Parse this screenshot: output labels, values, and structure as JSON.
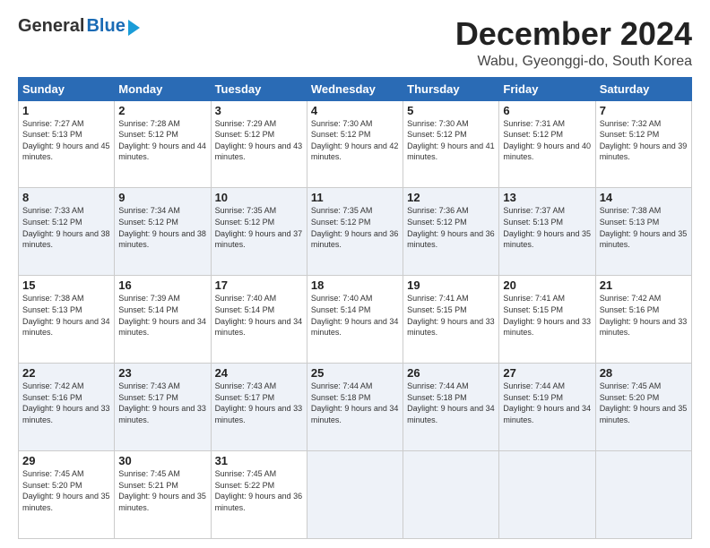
{
  "header": {
    "logo_general": "General",
    "logo_blue": "Blue",
    "month_title": "December 2024",
    "subtitle": "Wabu, Gyeonggi-do, South Korea"
  },
  "weekdays": [
    "Sunday",
    "Monday",
    "Tuesday",
    "Wednesday",
    "Thursday",
    "Friday",
    "Saturday"
  ],
  "weeks": [
    [
      {
        "day": "1",
        "sunrise": "7:27 AM",
        "sunset": "5:13 PM",
        "daylight": "9 hours and 45 minutes."
      },
      {
        "day": "2",
        "sunrise": "7:28 AM",
        "sunset": "5:12 PM",
        "daylight": "9 hours and 44 minutes."
      },
      {
        "day": "3",
        "sunrise": "7:29 AM",
        "sunset": "5:12 PM",
        "daylight": "9 hours and 43 minutes."
      },
      {
        "day": "4",
        "sunrise": "7:30 AM",
        "sunset": "5:12 PM",
        "daylight": "9 hours and 42 minutes."
      },
      {
        "day": "5",
        "sunrise": "7:30 AM",
        "sunset": "5:12 PM",
        "daylight": "9 hours and 41 minutes."
      },
      {
        "day": "6",
        "sunrise": "7:31 AM",
        "sunset": "5:12 PM",
        "daylight": "9 hours and 40 minutes."
      },
      {
        "day": "7",
        "sunrise": "7:32 AM",
        "sunset": "5:12 PM",
        "daylight": "9 hours and 39 minutes."
      }
    ],
    [
      {
        "day": "8",
        "sunrise": "7:33 AM",
        "sunset": "5:12 PM",
        "daylight": "9 hours and 38 minutes."
      },
      {
        "day": "9",
        "sunrise": "7:34 AM",
        "sunset": "5:12 PM",
        "daylight": "9 hours and 38 minutes."
      },
      {
        "day": "10",
        "sunrise": "7:35 AM",
        "sunset": "5:12 PM",
        "daylight": "9 hours and 37 minutes."
      },
      {
        "day": "11",
        "sunrise": "7:35 AM",
        "sunset": "5:12 PM",
        "daylight": "9 hours and 36 minutes."
      },
      {
        "day": "12",
        "sunrise": "7:36 AM",
        "sunset": "5:12 PM",
        "daylight": "9 hours and 36 minutes."
      },
      {
        "day": "13",
        "sunrise": "7:37 AM",
        "sunset": "5:13 PM",
        "daylight": "9 hours and 35 minutes."
      },
      {
        "day": "14",
        "sunrise": "7:38 AM",
        "sunset": "5:13 PM",
        "daylight": "9 hours and 35 minutes."
      }
    ],
    [
      {
        "day": "15",
        "sunrise": "7:38 AM",
        "sunset": "5:13 PM",
        "daylight": "9 hours and 34 minutes."
      },
      {
        "day": "16",
        "sunrise": "7:39 AM",
        "sunset": "5:14 PM",
        "daylight": "9 hours and 34 minutes."
      },
      {
        "day": "17",
        "sunrise": "7:40 AM",
        "sunset": "5:14 PM",
        "daylight": "9 hours and 34 minutes."
      },
      {
        "day": "18",
        "sunrise": "7:40 AM",
        "sunset": "5:14 PM",
        "daylight": "9 hours and 34 minutes."
      },
      {
        "day": "19",
        "sunrise": "7:41 AM",
        "sunset": "5:15 PM",
        "daylight": "9 hours and 33 minutes."
      },
      {
        "day": "20",
        "sunrise": "7:41 AM",
        "sunset": "5:15 PM",
        "daylight": "9 hours and 33 minutes."
      },
      {
        "day": "21",
        "sunrise": "7:42 AM",
        "sunset": "5:16 PM",
        "daylight": "9 hours and 33 minutes."
      }
    ],
    [
      {
        "day": "22",
        "sunrise": "7:42 AM",
        "sunset": "5:16 PM",
        "daylight": "9 hours and 33 minutes."
      },
      {
        "day": "23",
        "sunrise": "7:43 AM",
        "sunset": "5:17 PM",
        "daylight": "9 hours and 33 minutes."
      },
      {
        "day": "24",
        "sunrise": "7:43 AM",
        "sunset": "5:17 PM",
        "daylight": "9 hours and 33 minutes."
      },
      {
        "day": "25",
        "sunrise": "7:44 AM",
        "sunset": "5:18 PM",
        "daylight": "9 hours and 34 minutes."
      },
      {
        "day": "26",
        "sunrise": "7:44 AM",
        "sunset": "5:18 PM",
        "daylight": "9 hours and 34 minutes."
      },
      {
        "day": "27",
        "sunrise": "7:44 AM",
        "sunset": "5:19 PM",
        "daylight": "9 hours and 34 minutes."
      },
      {
        "day": "28",
        "sunrise": "7:45 AM",
        "sunset": "5:20 PM",
        "daylight": "9 hours and 35 minutes."
      }
    ],
    [
      {
        "day": "29",
        "sunrise": "7:45 AM",
        "sunset": "5:20 PM",
        "daylight": "9 hours and 35 minutes."
      },
      {
        "day": "30",
        "sunrise": "7:45 AM",
        "sunset": "5:21 PM",
        "daylight": "9 hours and 35 minutes."
      },
      {
        "day": "31",
        "sunrise": "7:45 AM",
        "sunset": "5:22 PM",
        "daylight": "9 hours and 36 minutes."
      },
      null,
      null,
      null,
      null
    ]
  ],
  "labels": {
    "sunrise": "Sunrise:",
    "sunset": "Sunset:",
    "daylight": "Daylight:"
  }
}
